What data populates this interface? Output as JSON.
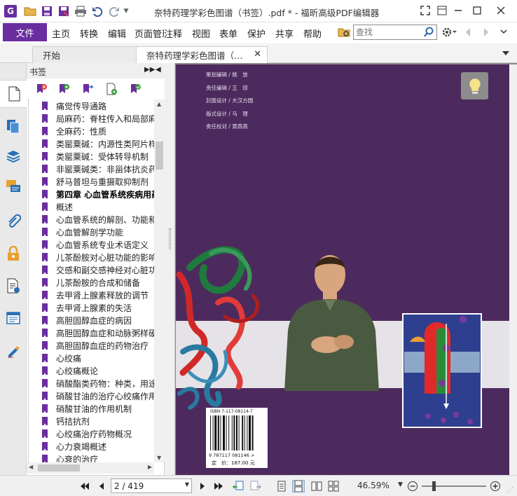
{
  "window": {
    "title": "奈特药理学彩色图谱（书签）.pdf * - 福昕高级PDF编辑器",
    "app_icon_letter": "G"
  },
  "menubar": {
    "file": "文件",
    "items": [
      "主页",
      "转换",
      "编辑",
      "页面管理",
      "注释",
      "视图",
      "表单",
      "保护",
      "共享",
      "帮助"
    ],
    "search_placeholder": "查找"
  },
  "tabs": {
    "start": "开始",
    "document": "奈特药理学彩色图谱（…"
  },
  "bookmarks": {
    "title": "书签",
    "items": [
      {
        "label": "痛觉传导通路",
        "chapter": false
      },
      {
        "label": "局麻药：脊柱传入和局部麻醉",
        "chapter": false
      },
      {
        "label": "全麻药：性质",
        "chapter": false
      },
      {
        "label": "类罂粟碱：内源性类阿片样物质",
        "chapter": false
      },
      {
        "label": "类罂粟碱：受体转导机制",
        "chapter": false
      },
      {
        "label": "非罂粟碱类：非甾体抗炎药",
        "chapter": false
      },
      {
        "label": "舒马普坦与重摄取抑制剂",
        "chapter": false
      },
      {
        "label": "第四章 心血管系统疾病用药",
        "chapter": true
      },
      {
        "label": "概述",
        "chapter": false
      },
      {
        "label": "心血管系统的解剖、功能和病理",
        "chapter": false
      },
      {
        "label": "心血管解剖学功能",
        "chapter": false
      },
      {
        "label": "心血管系统专业术语定义",
        "chapter": false
      },
      {
        "label": "儿茶酚胺对心脏功能的影响",
        "chapter": false
      },
      {
        "label": "交感和副交感神经对心脏功能",
        "chapter": false
      },
      {
        "label": "儿茶酚胺的合成和储备",
        "chapter": false
      },
      {
        "label": "去甲肾上腺素释放的调节",
        "chapter": false
      },
      {
        "label": "去甲肾上腺素的失活",
        "chapter": false
      },
      {
        "label": "高胆固醇血症的病因",
        "chapter": false
      },
      {
        "label": "高胆固醇血症和动脉粥样硬化",
        "chapter": false
      },
      {
        "label": "高胆固醇血症的药物治疗",
        "chapter": false
      },
      {
        "label": "心绞痛",
        "chapter": false
      },
      {
        "label": "心绞痛概论",
        "chapter": false
      },
      {
        "label": "硝酸酯类药物：种类，用途",
        "chapter": false
      },
      {
        "label": "硝酸甘油的治疗心绞痛作用",
        "chapter": false
      },
      {
        "label": "硝酸甘油的作用机制",
        "chapter": false
      },
      {
        "label": "钙拮抗剂",
        "chapter": false
      },
      {
        "label": "心绞痛治疗药物概况",
        "chapter": false
      },
      {
        "label": "心力衰竭概述",
        "chapter": false
      },
      {
        "label": "心衰的治疗",
        "chapter": false
      }
    ]
  },
  "document_page": {
    "credits": [
      "策划编辑 / 姚　放",
      "责任编辑 / 王　琼",
      "封面设计 / 大汉方圆",
      "版式设计 / 马　理",
      "责任校对 / 黄燕燕"
    ],
    "isbn": "ISBN 7-117-08114-7",
    "barcode_number": "9 787117 081146 >",
    "price": "定　价：187.00 元"
  },
  "statusbar": {
    "page_value": "2 / 419",
    "zoom": "46.59%"
  },
  "colors": {
    "brand": "#6a2da0",
    "page_background": "#4d2a5e"
  }
}
